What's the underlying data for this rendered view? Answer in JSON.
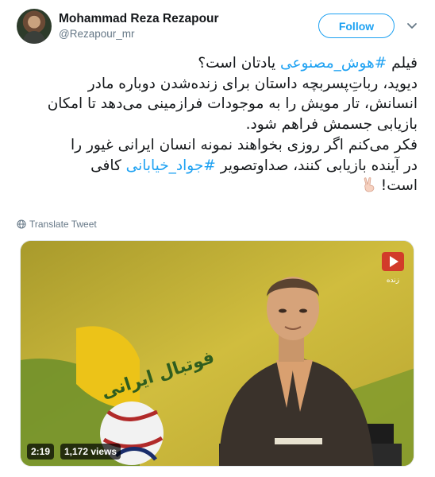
{
  "user": {
    "display_name": "Mohammad Reza Rezapour",
    "handle": "@Rezapour_mr"
  },
  "follow_label": "Follow",
  "tweet": {
    "lines": [
      [
        {
          "t": "فیلم "
        },
        {
          "t": "#هوش_مصنوعی",
          "tag": true
        },
        {
          "t": " یادتان است؟"
        }
      ],
      [
        {
          "t": "دیوید، رباتِ‌پسربچه داستان برای زنده‌شدن دوباره مادر"
        }
      ],
      [
        {
          "t": "انسانش، تار مویش را به موجودات فرازمینی می‌دهد تا امکان"
        }
      ],
      [
        {
          "t": "بازیابی جسمش فراهم شود."
        }
      ],
      [
        {
          "t": "فکر می‌کنم اگر روزی بخواهند نمونه انسان ایرانی غیور را"
        }
      ],
      [
        {
          "t": "در آینده بازیابی کنند، صداوتصویر "
        },
        {
          "t": "#جواد_خیابانی",
          "tag": true
        },
        {
          "t": " کافی"
        }
      ],
      [
        {
          "t": "است! "
        },
        {
          "t": "✌",
          "emoji": true
        }
      ]
    ]
  },
  "translate_label": "Translate Tweet",
  "media": {
    "channel_label": "زنده",
    "backdrop_text": "فوتبال ایرانی",
    "duration": "2:19",
    "views": "1,172 views"
  },
  "colors": {
    "accent": "#1da1f2",
    "muted": "#657786",
    "text": "#14171a",
    "video_backdrop": "#cbb63c"
  },
  "icons": {
    "caret": "chevron-down-icon",
    "translate": "globe-icon",
    "channel": "play-logo-icon",
    "emoji": "victory-hand-icon"
  }
}
